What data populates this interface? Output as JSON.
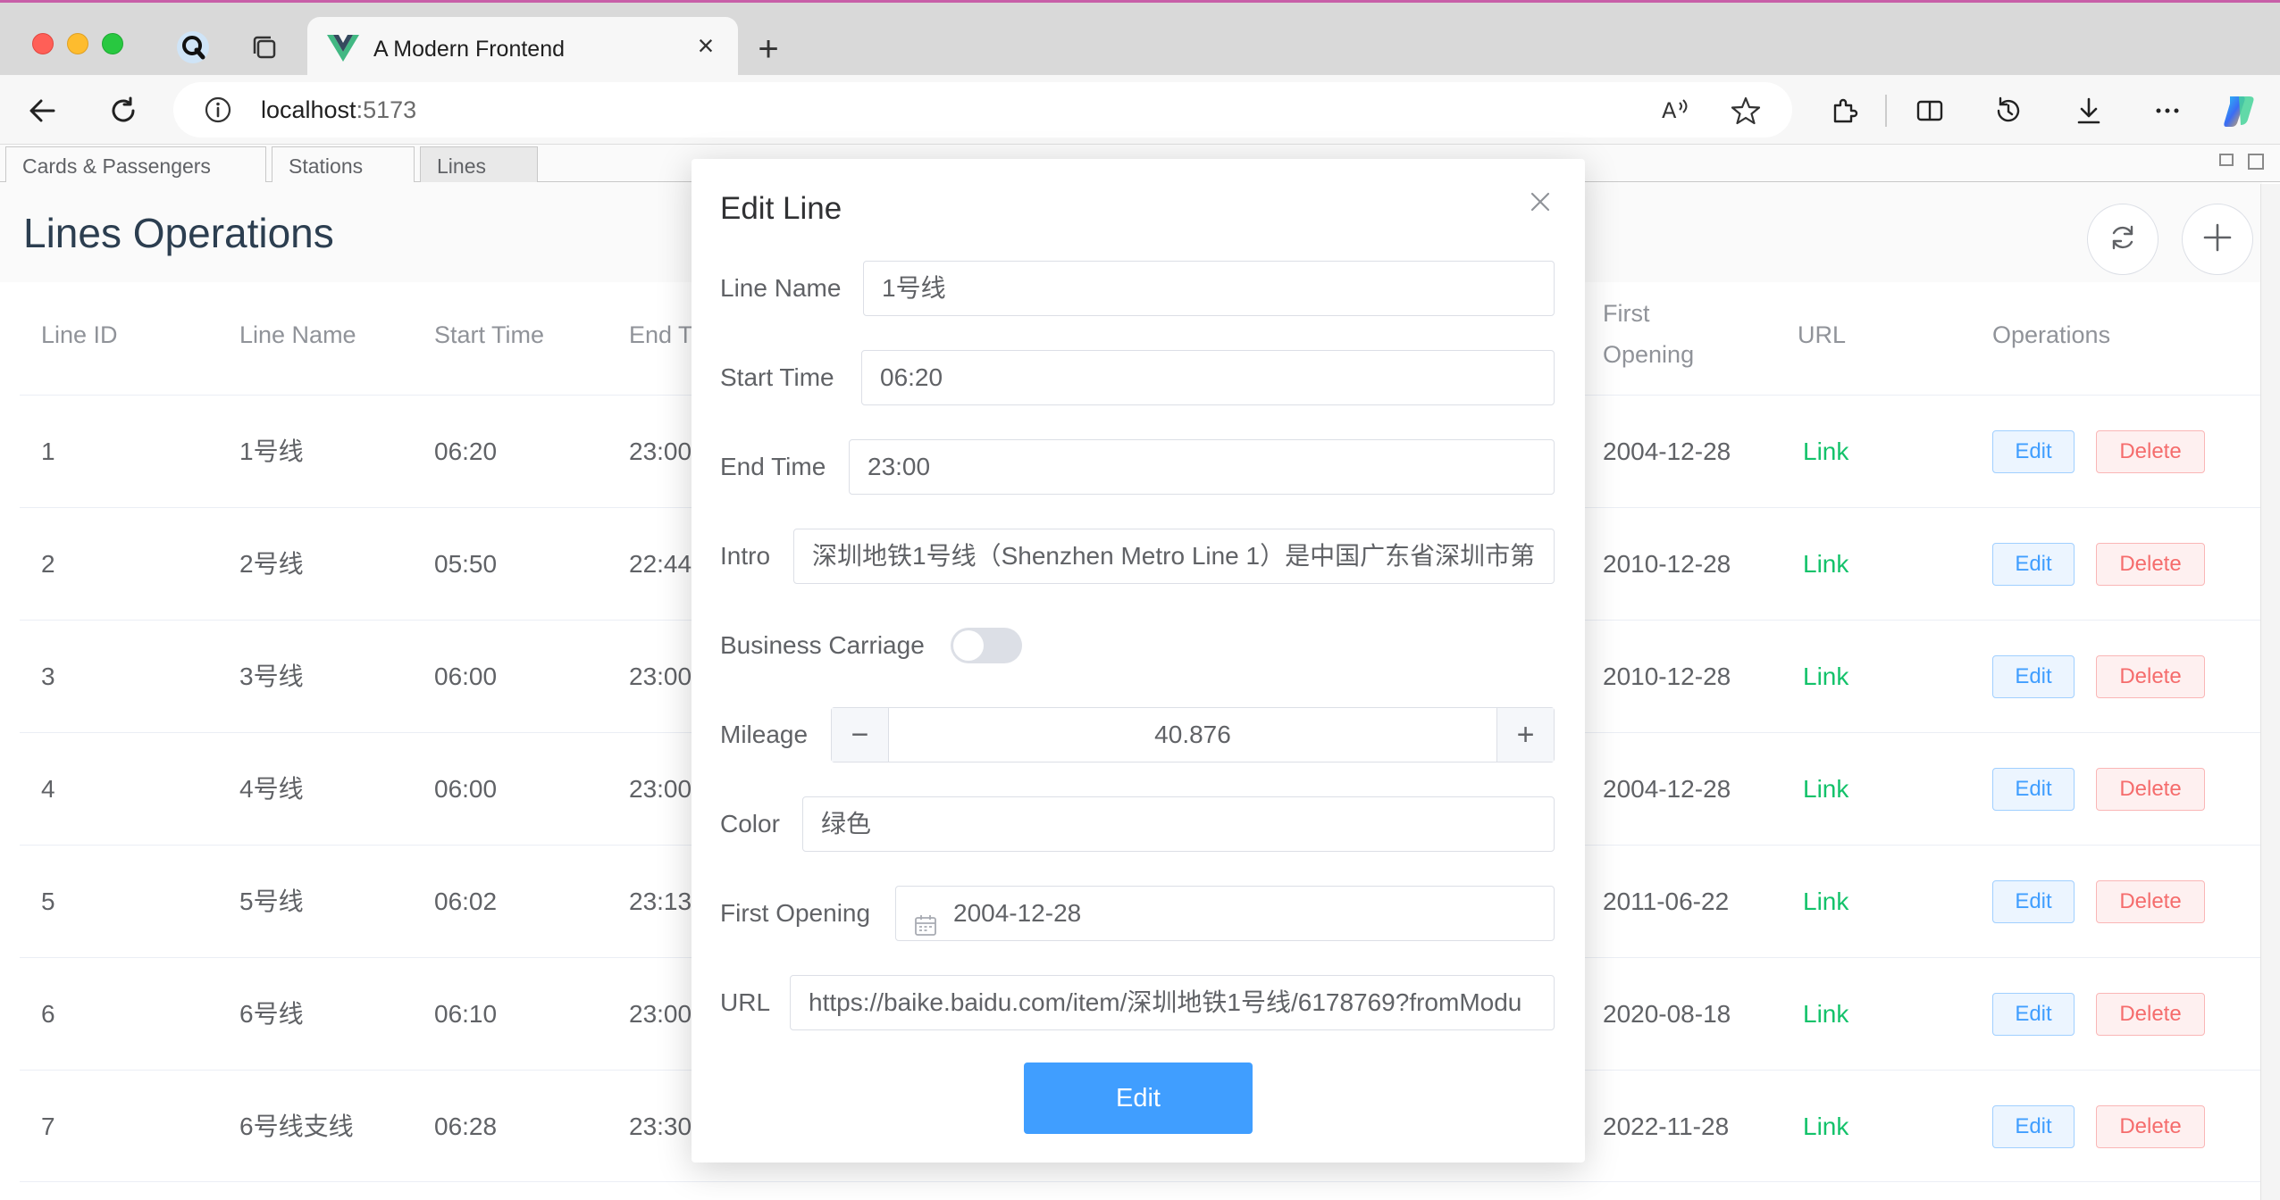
{
  "browser": {
    "tab_title": "A Modern Frontend",
    "url_host": "localhost",
    "url_port": ":5173"
  },
  "app_tabs": [
    "Cards & Passengers",
    "Stations",
    "Lines"
  ],
  "page": {
    "title": "Lines Operations"
  },
  "table": {
    "headers": {
      "line_id": "Line ID",
      "line_name": "Line Name",
      "start_time": "Start Time",
      "end_time": "End T",
      "first_opening_1": "First",
      "first_opening_2": "Opening",
      "url": "URL",
      "operations": "Operations"
    },
    "rows": [
      {
        "id": "1",
        "name": "1号线",
        "start": "06:20",
        "end": "23:00",
        "opening": "2004-12-28",
        "url": "Link",
        "edit": "Edit",
        "delete": "Delete"
      },
      {
        "id": "2",
        "name": "2号线",
        "start": "05:50",
        "end": "22:44",
        "opening": "2010-12-28",
        "url": "Link",
        "edit": "Edit",
        "delete": "Delete"
      },
      {
        "id": "3",
        "name": "3号线",
        "start": "06:00",
        "end": "23:00",
        "opening": "2010-12-28",
        "url": "Link",
        "edit": "Edit",
        "delete": "Delete"
      },
      {
        "id": "4",
        "name": "4号线",
        "start": "06:00",
        "end": "23:00",
        "opening": "2004-12-28",
        "url": "Link",
        "edit": "Edit",
        "delete": "Delete"
      },
      {
        "id": "5",
        "name": "5号线",
        "start": "06:02",
        "end": "23:13",
        "opening": "2011-06-22",
        "url": "Link",
        "edit": "Edit",
        "delete": "Delete"
      },
      {
        "id": "6",
        "name": "6号线",
        "start": "06:10",
        "end": "23:00",
        "opening": "2020-08-18",
        "url": "Link",
        "edit": "Edit",
        "delete": "Delete"
      },
      {
        "id": "7",
        "name": "6号线支线",
        "start": "06:28",
        "end": "23:30",
        "opening": "2022-11-28",
        "url": "Link",
        "edit": "Edit",
        "delete": "Delete"
      }
    ]
  },
  "dialog": {
    "title": "Edit Line",
    "line_name_label": "Line Name",
    "line_name_value": "1号线",
    "start_time_label": "Start Time",
    "start_time_value": "06:20",
    "end_time_label": "End Time",
    "end_time_value": "23:00",
    "intro_label": "Intro",
    "intro_value": "深圳地铁1号线（Shenzhen Metro Line 1）是中国广东省深圳市第",
    "business_carriage_label": "Business Carriage",
    "business_carriage_on": false,
    "mileage_label": "Mileage",
    "mileage_value": "40.876",
    "color_label": "Color",
    "color_value": "绿色",
    "first_opening_label": "First Opening",
    "first_opening_value": "2004-12-28",
    "url_label": "URL",
    "url_value": "https://baike.baidu.com/item/深圳地铁1号线/6178769?fromModu",
    "submit_label": "Edit"
  },
  "colors": {
    "primary": "#409eff",
    "danger": "#f56c6c",
    "link": "#13c26a",
    "title": "#2c3e50"
  },
  "icons": {
    "toolbar": [
      "back-icon",
      "reload-icon",
      "info-icon",
      "read-aloud-icon",
      "favorite-icon",
      "extensions-icon",
      "split-screen-icon",
      "history-icon",
      "download-icon",
      "more-icon",
      "copilot-icon"
    ],
    "page": [
      "refresh-icon",
      "add-icon"
    ]
  }
}
